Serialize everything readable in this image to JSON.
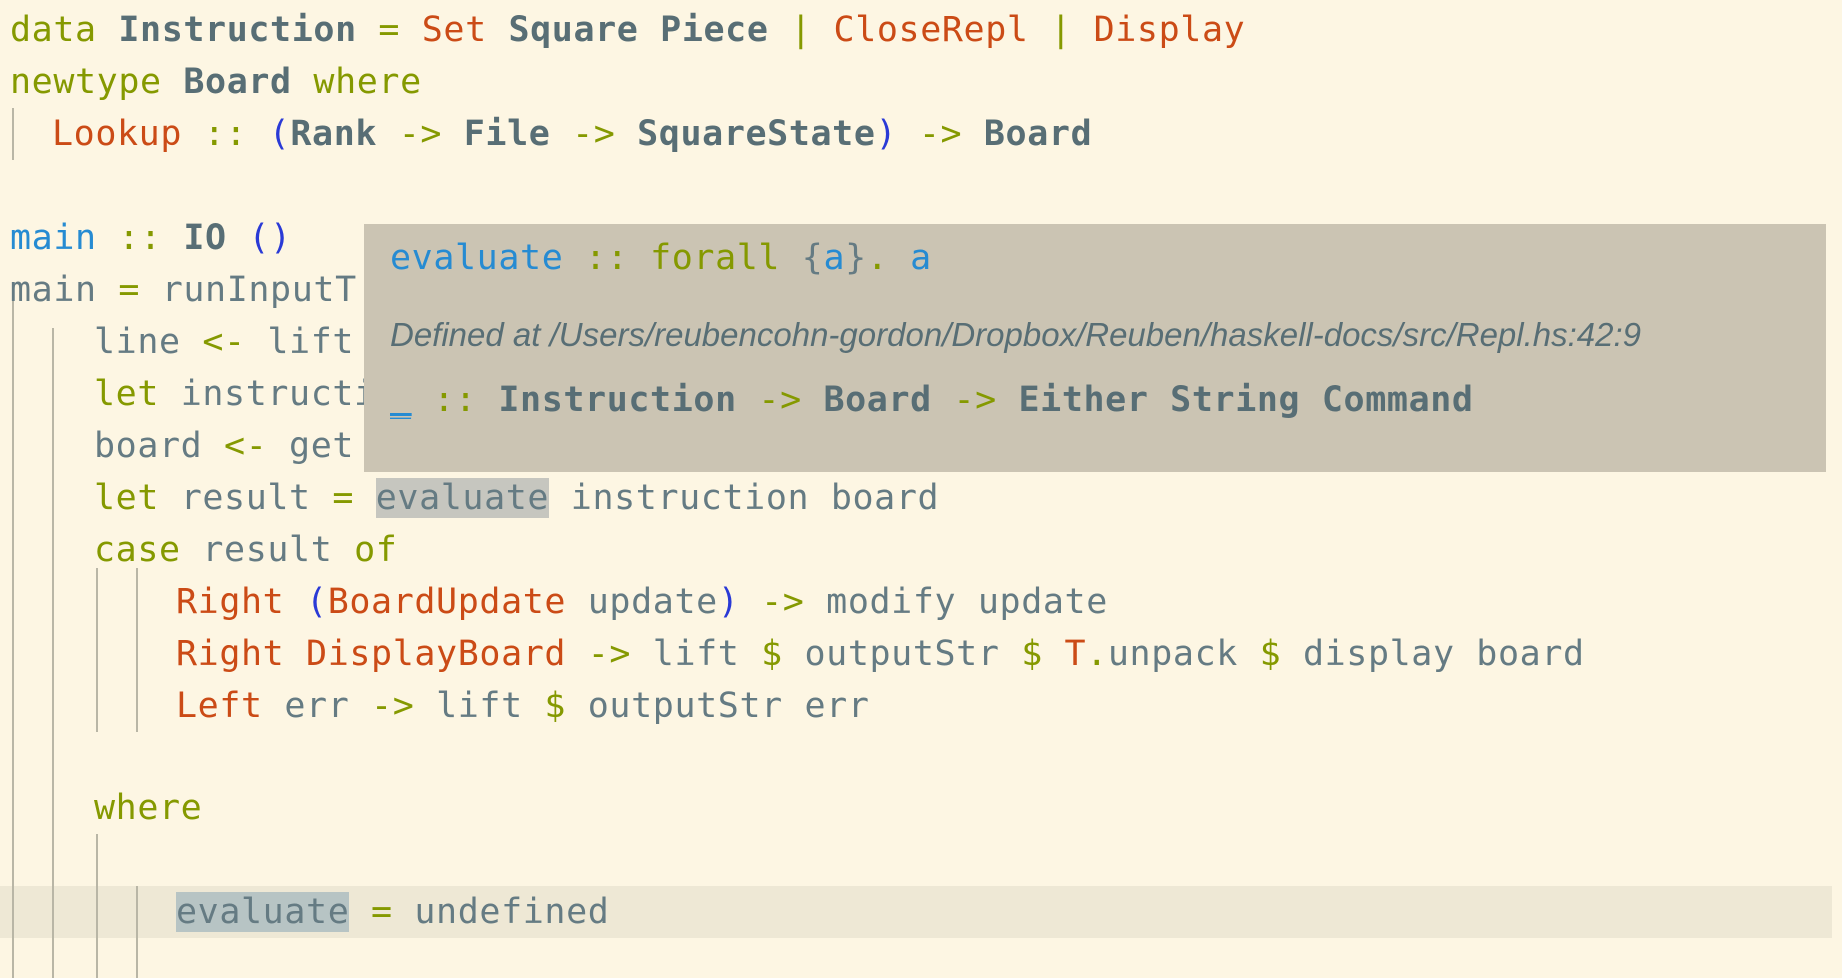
{
  "code": {
    "l1": [
      "data",
      "Instruction",
      "=",
      "Set",
      "Square",
      "Piece",
      "|",
      "CloseRepl",
      "|",
      "Display"
    ],
    "l2": [
      "newtype",
      "Board",
      "where"
    ],
    "l3": [
      "Lookup",
      "::",
      "(",
      "Rank",
      "->",
      "File",
      "->",
      "SquareState",
      ")",
      "->",
      "Board"
    ],
    "l4": [
      "main",
      "::",
      "IO",
      "()"
    ],
    "l5": [
      "main",
      "=",
      "runInputT"
    ],
    "l6": [
      "line",
      "<-",
      "lift"
    ],
    "l7": [
      "let",
      "instructi"
    ],
    "l8": [
      "board",
      "<-",
      "get"
    ],
    "l9": [
      "let",
      "result",
      "=",
      "evaluate",
      "instruction board"
    ],
    "l10": [
      "case",
      "result",
      "of"
    ],
    "l11": [
      "Right",
      "(",
      "BoardUpdate",
      "update",
      ")",
      "->",
      "modify update"
    ],
    "l12": [
      "Right",
      "DisplayBoard",
      "->",
      "lift",
      "$",
      "outputStr",
      "$",
      "T",
      ".",
      "unpack",
      "$",
      "display board"
    ],
    "l13": [
      "Left",
      "err",
      "->",
      "lift",
      "$",
      "outputStr err"
    ],
    "l14": [
      "where"
    ],
    "l15": [
      "evaluate",
      "=",
      "undefined"
    ]
  },
  "tooltip": {
    "name": "evaluate",
    "sep": "::",
    "forall": "forall",
    "braces_open": "{",
    "var": "a",
    "braces_close": "}",
    "dot": ".",
    "result": "a",
    "defined_at": "Defined at /Users/reubencohn-gordon/Dropbox/Reuben/haskell-docs/src/Repl.hs:42:9",
    "hole": "_",
    "hole_sep": "::",
    "hole_types": [
      "Instruction",
      "->",
      "Board",
      "->",
      "Either String Command"
    ]
  },
  "colors": {
    "background": "#fdf6e3",
    "keyword": "#859900",
    "constructor": "#cb4b16",
    "type": "#586e75",
    "function": "#268bd2",
    "tooltip_bg": "#cbc4b3"
  }
}
